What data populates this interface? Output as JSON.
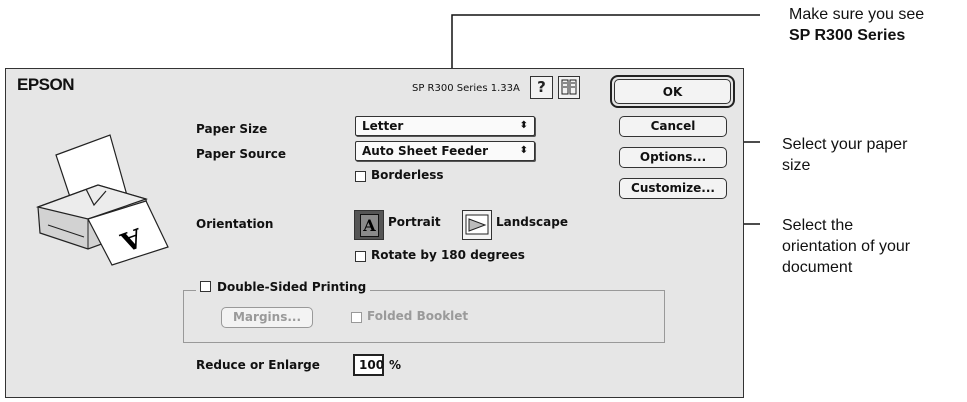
{
  "callouts": {
    "top_line1": "Make sure you see",
    "top_line2": "SP R300 Series",
    "paper_size": "Select your paper\nsize",
    "orientation": "Select the\norientation of your\ndocument"
  },
  "dialog": {
    "brand": "EPSON",
    "version": "SP R300 Series 1.33A",
    "help_symbol": "?",
    "buttons": {
      "ok": "OK",
      "cancel": "Cancel",
      "options": "Options...",
      "customize": "Customize..."
    },
    "paper_size": {
      "label": "Paper Size",
      "value": "Letter"
    },
    "paper_source": {
      "label": "Paper Source",
      "value": "Auto Sheet Feeder"
    },
    "borderless": {
      "label": "Borderless",
      "checked": false
    },
    "orientation": {
      "label": "Orientation",
      "portrait": "Portrait",
      "landscape": "Landscape",
      "selected": "Portrait",
      "portrait_glyph": "A"
    },
    "rotate": {
      "label": "Rotate by 180 degrees",
      "checked": false
    },
    "double_sided": {
      "label": "Double-Sided Printing",
      "checked": false
    },
    "margins_button": "Margins...",
    "folded_booklet": {
      "label": "Folded Booklet",
      "checked": false
    },
    "reduce": {
      "label": "Reduce or Enlarge",
      "value": "100",
      "unit": "%"
    },
    "popup_arrow": "⬍"
  }
}
